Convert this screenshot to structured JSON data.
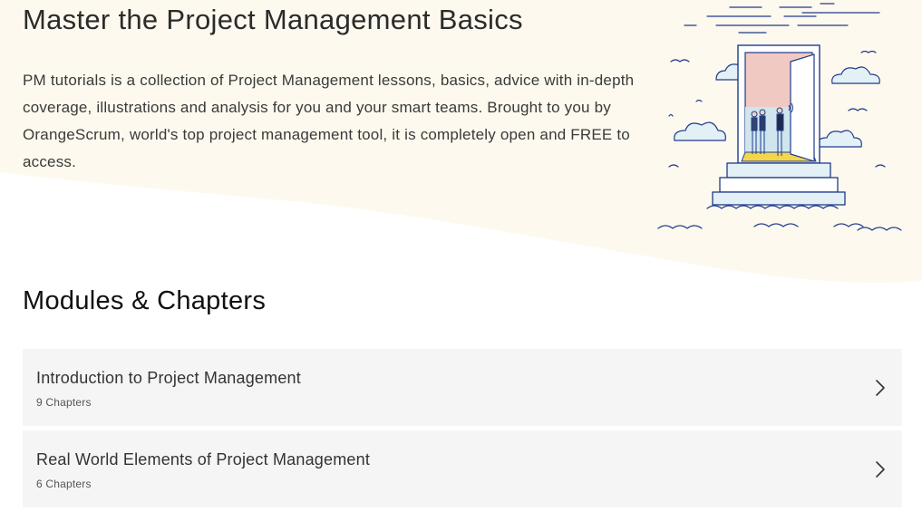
{
  "hero": {
    "title": "Master the Project Management Basics",
    "description": "PM tutorials is a collection of Project Management lessons, basics, advice with in-depth coverage, illustrations and analysis for you and your smart teams. Brought to you by OrangeScrum, world's top project management tool, it is completely open and FREE to access."
  },
  "modules": {
    "heading": "Modules & Chapters",
    "items": [
      {
        "title": "Introduction to Project Management",
        "count": "9 Chapters"
      },
      {
        "title": "Real World Elements of Project Management",
        "count": "6 Chapters"
      }
    ]
  },
  "icons": {
    "hero_illustration": "door-in-clouds-illustration",
    "chevron": "chevron-right-icon"
  },
  "colors": {
    "background_wave": "#fdf9ee",
    "card_background": "#f5f5f5",
    "illustration_stroke": "#1f3b8c",
    "cloud_fill": "#e3f1f6",
    "door_pink": "#f1c9c3",
    "floor_yellow": "#f3d64a"
  }
}
